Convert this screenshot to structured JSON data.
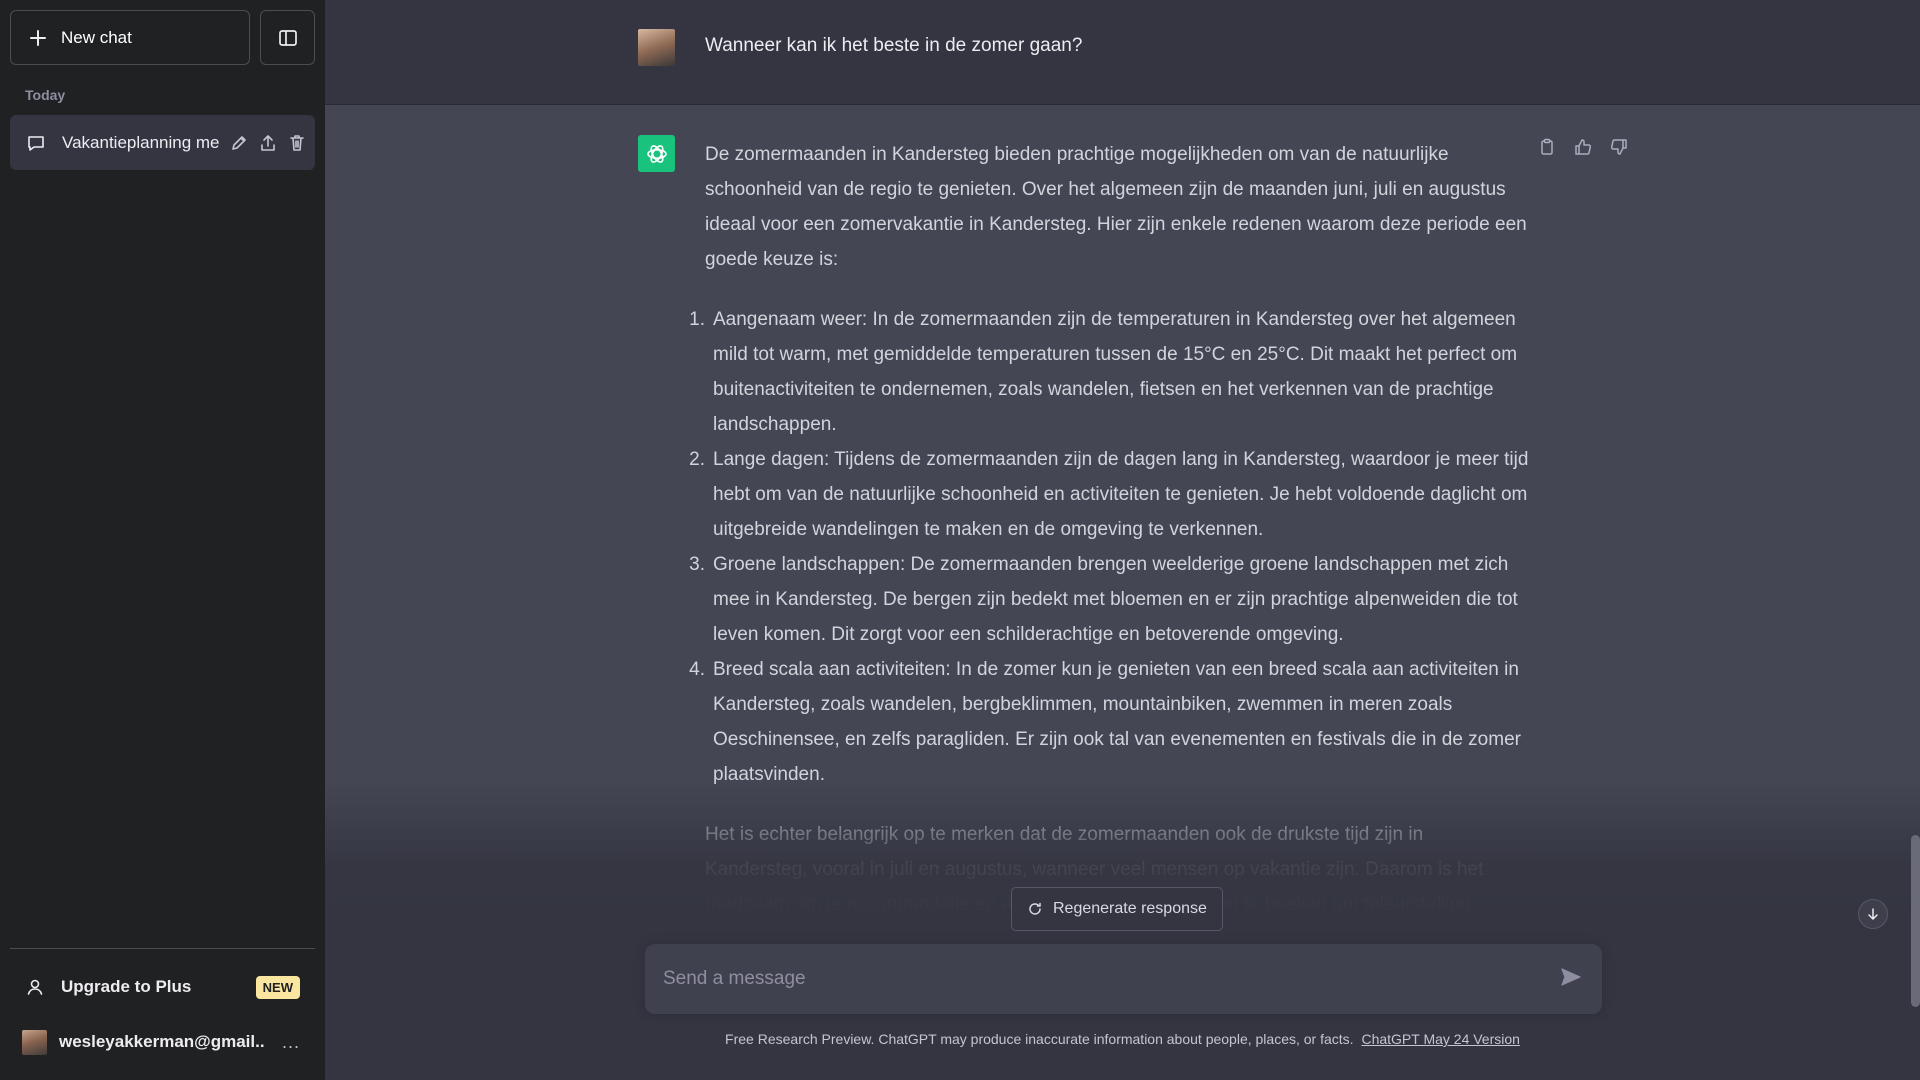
{
  "sidebar": {
    "new_chat_label": "New chat",
    "section_label": "Today",
    "history": [
      {
        "title": "Vakantieplanning me"
      }
    ],
    "upgrade_label": "Upgrade to Plus",
    "new_badge": "NEW",
    "user_email": "wesleyakkerman@gmail....",
    "more_label": "..."
  },
  "conversation": {
    "user_message": "Wanneer kan ik het beste in de zomer gaan?",
    "assistant": {
      "intro": "De zomermaanden in Kandersteg bieden prachtige mogelijkheden om van de natuurlijke schoonheid van de regio te genieten. Over het algemeen zijn de maanden juni, juli en augustus ideaal voor een zomervakantie in Kandersteg. Hier zijn enkele redenen waarom deze periode een goede keuze is:",
      "items": [
        {
          "num": "1.",
          "text": "Aangenaam weer: In de zomermaanden zijn de temperaturen in Kandersteg over het algemeen mild tot warm, met gemiddelde temperaturen tussen de 15°C en 25°C. Dit maakt het perfect om buitenactiviteiten te ondernemen, zoals wandelen, fietsen en het verkennen van de prachtige landschappen."
        },
        {
          "num": "2.",
          "text": "Lange dagen: Tijdens de zomermaanden zijn de dagen lang in Kandersteg, waardoor je meer tijd hebt om van de natuurlijke schoonheid en activiteiten te genieten. Je hebt voldoende daglicht om uitgebreide wandelingen te maken en de omgeving te verkennen."
        },
        {
          "num": "3.",
          "text": "Groene landschappen: De zomermaanden brengen weelderige groene landschappen met zich mee in Kandersteg. De bergen zijn bedekt met bloemen en er zijn prachtige alpenweiden die tot leven komen. Dit zorgt voor een schilderachtige en betoverende omgeving."
        },
        {
          "num": "4.",
          "text": "Breed scala aan activiteiten: In de zomer kun je genieten van een breed scala aan activiteiten in Kandersteg, zoals wandelen, bergbeklimmen, mountainbiken, zwemmen in meren zoals Oeschinensee, en zelfs paragliden. Er zijn ook tal van evenementen en festivals die in de zomer plaatsvinden."
        }
      ],
      "outro": "Het is echter belangrijk op te merken dat de zomermaanden ook de drukste tijd zijn in Kandersteg, vooral in juli en augustus, wanneer veel mensen op vakantie zijn. Daarom is het raadzaam om je accommodatie en activiteiten ruim van tevoren te boeken om teleurstelling"
    }
  },
  "composer": {
    "regenerate_label": "Regenerate response",
    "placeholder": "Send a message"
  },
  "footer": {
    "disclaimer": "Free Research Preview. ChatGPT may produce inaccurate information about people, places, or facts.",
    "version_link": "ChatGPT May 24 Version"
  },
  "colors": {
    "sidebar_bg": "#202123",
    "main_bg": "#343541",
    "assistant_bg": "#444654",
    "brand_green": "#19c37d",
    "badge_yellow": "#fae69e"
  }
}
